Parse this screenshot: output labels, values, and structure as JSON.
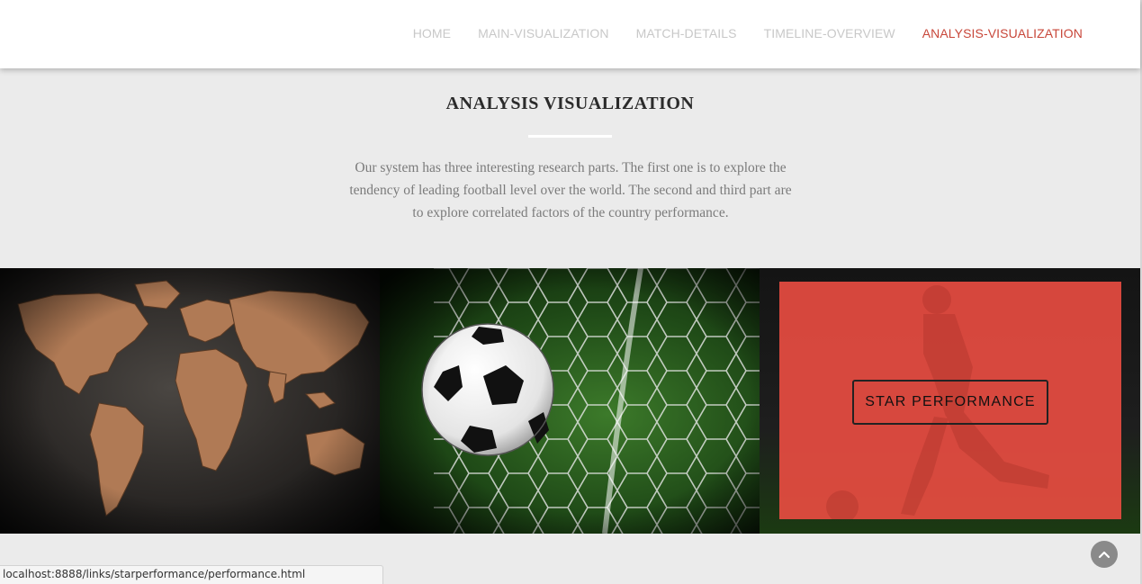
{
  "nav": {
    "items": [
      {
        "label": "HOME",
        "active": false
      },
      {
        "label": "MAIN-VISUALIZATION",
        "active": false
      },
      {
        "label": "MATCH-DETAILS",
        "active": false
      },
      {
        "label": "TIMELINE-OVERVIEW",
        "active": false
      },
      {
        "label": "ANALYSIS-VISUALIZATION",
        "active": true
      }
    ]
  },
  "section": {
    "title": "ANALYSIS VISUALIZATION",
    "description": "Our system has three interesting research parts. The first one is to explore the tendency of leading football level over the world. The second and third part are to explore correlated factors of the country performance."
  },
  "tiles": {
    "map_icon": "world-map-image",
    "ball_icon": "soccer-ball-net-image",
    "star": {
      "button_label": "STAR PERFORMANCE",
      "overlay_color": "#e74c41"
    }
  },
  "colors": {
    "accent": "#c8473a",
    "nav_inactive": "#c8c8c8",
    "page_bg": "#ebebeb"
  },
  "status_bar": {
    "url": "localhost:8888/links/starperformance/performance.html"
  },
  "back_to_top_icon": "chevron-up-icon"
}
